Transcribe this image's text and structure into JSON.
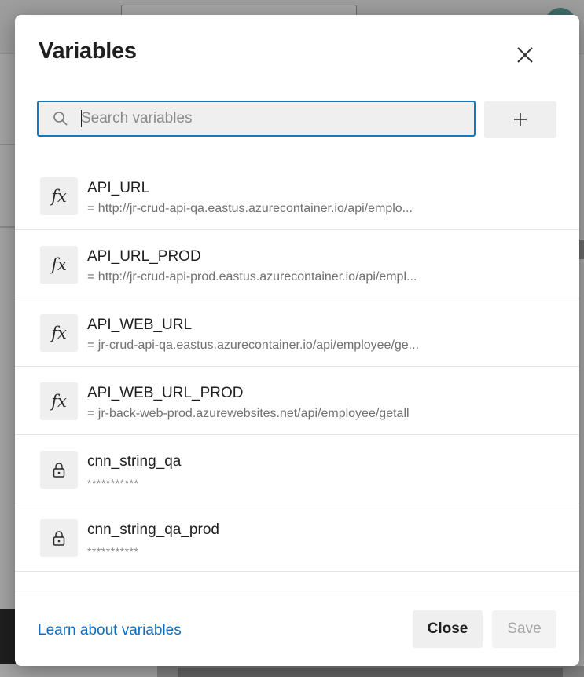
{
  "dialog": {
    "title": "Variables",
    "search_placeholder": "Search variables",
    "search_value": ""
  },
  "variables": [
    {
      "name": "API_URL",
      "value": "= http://jr-crud-api-qa.eastus.azurecontainer.io/api/emplo...",
      "icon": "fx-icon",
      "secret": false
    },
    {
      "name": "API_URL_PROD",
      "value": "= http://jr-crud-api-prod.eastus.azurecontainer.io/api/empl...",
      "icon": "fx-icon",
      "secret": false
    },
    {
      "name": "API_WEB_URL",
      "value": "= jr-crud-api-qa.eastus.azurecontainer.io/api/employee/ge...",
      "icon": "fx-icon",
      "secret": false
    },
    {
      "name": "API_WEB_URL_PROD",
      "value": "= jr-back-web-prod.azurewebsites.net/api/employee/getall",
      "icon": "fx-icon",
      "secret": false
    },
    {
      "name": "cnn_string_qa",
      "value": "***********",
      "icon": "lock-icon",
      "secret": true
    },
    {
      "name": "cnn_string_qa_prod",
      "value": "***********",
      "icon": "lock-icon",
      "secret": true
    }
  ],
  "icons": {
    "fx_glyph": "fx"
  },
  "footer": {
    "learn_link": "Learn about variables",
    "close_label": "Close",
    "save_label": "Save"
  },
  "colors": {
    "accent": "#0e7ac6",
    "link": "#106ebe"
  }
}
